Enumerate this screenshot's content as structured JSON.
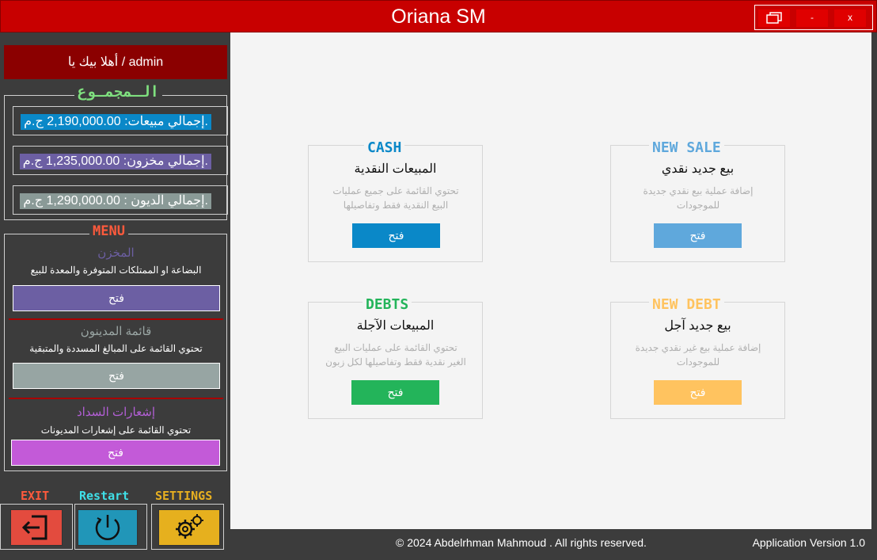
{
  "window": {
    "title": "Oriana SM",
    "restore_label": "",
    "minimize_label": "-",
    "close_label": "x"
  },
  "sidebar": {
    "welcome": "أهلا بيك يا / admin",
    "totals_title": "الـمجمـوع",
    "totals": [
      {
        "label": "إجمالي مبيعات: 2,190,000.00 ج.م.",
        "color": "#0a88c8"
      },
      {
        "label": "إجمالي مخزون: 1,235,000.00 ج.م.",
        "color": "#6c5fa3"
      },
      {
        "label": "إجمالي الديون : 1,290,000.00 ج.م.",
        "color": "#8a9a97"
      }
    ],
    "menu_title": "MENU",
    "menu_items": [
      {
        "title": "المخزن",
        "desc": "البضاعة او الممتلكات المتوفرة والمعدة للبيع",
        "button": "فتح",
        "title_color": "#6c5fa3",
        "button_color": "#6c5fa3"
      },
      {
        "title": "قائمة المدينون",
        "desc": "تحتوي القائمة على المبالغ المسددة والمتبقية",
        "button": "فتح",
        "title_color": "#9aa6a4",
        "button_color": "#97a5a3"
      },
      {
        "title": "إشعارات السداد",
        "desc": "تحتوي القائمة على إشعارات المديونات",
        "button": "فتح",
        "title_color": "#b35fd6",
        "button_color": "#c35ad8"
      }
    ],
    "bottom": {
      "exit_label": "EXIT",
      "restart_label": "Restart",
      "settings_label": "SETTINGS"
    }
  },
  "cards": [
    {
      "eng": "CASH",
      "title": "المبيعات النقدية",
      "desc": "تحتوي القائمة على جميع عمليات البيع النقدية فقط وتفاصيلها",
      "button": "فتح",
      "color": "#0a88c8",
      "eng_color": "#0a88c8"
    },
    {
      "eng": "NEW SALE",
      "title": "بيع جديد نقدي",
      "desc": "إضافة عملية بيع نقدي جديدة للموجودات",
      "button": "فتح",
      "color": "#5fa8dc",
      "eng_color": "#5fa8dc"
    },
    {
      "eng": "DEBTS",
      "title": "المبيعات الآجلة",
      "desc": "تحتوي القائمة على عمليات البيع الغير نقدية فقط وتفاصيلها لكل زبون",
      "button": "فتح",
      "color": "#23b45a",
      "eng_color": "#23b45a"
    },
    {
      "eng": "NEW DEBT",
      "title": "بيع جديد آجل",
      "desc": "إضافة عملية بيع غير نقدي جديدة للموجودات",
      "button": "فتح",
      "color": "#ffc35f",
      "eng_color": "#ffc35f"
    }
  ],
  "footer": {
    "copyright": "© 2024 Abdelrhman Mahmoud . All rights reserved.",
    "version": "Application Version 1.0"
  }
}
